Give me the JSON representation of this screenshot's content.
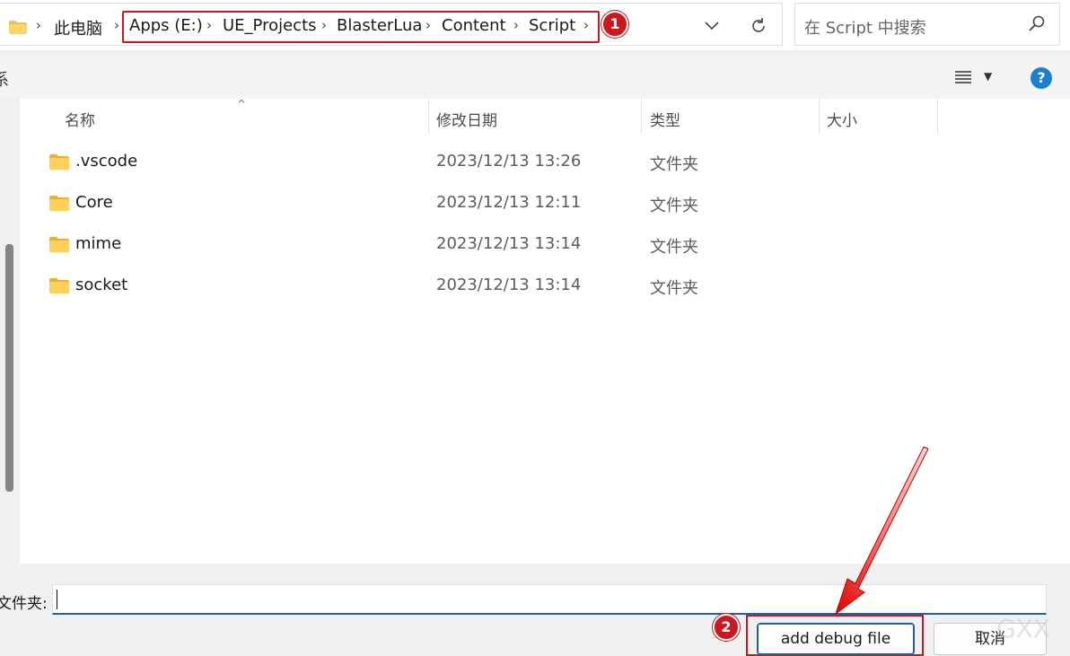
{
  "address_bar": {
    "root": "此电脑",
    "crumbs": [
      "Apps (E:)",
      "UE_Projects",
      "BlasterLua",
      "Content",
      "Script"
    ],
    "refresh_icon": "refresh-icon",
    "dropdown_icon": "chevron-down-icon"
  },
  "search": {
    "placeholder": "在 Script 中搜索",
    "icon": "search-icon"
  },
  "toolbar": {
    "left_text": "系",
    "view_icon": "list-view-icon",
    "help_label": "?"
  },
  "columns": {
    "name": "名称",
    "date": "修改日期",
    "type": "类型",
    "size": "大小"
  },
  "files": [
    {
      "name": ".vscode",
      "date": "2023/12/13 13:26",
      "type": "文件夹"
    },
    {
      "name": "Core",
      "date": "2023/12/13 12:11",
      "type": "文件夹"
    },
    {
      "name": "mime",
      "date": "2023/12/13 13:14",
      "type": "文件夹"
    },
    {
      "name": "socket",
      "date": "2023/12/13 13:14",
      "type": "文件夹"
    }
  ],
  "bottom": {
    "folder_label": "文件夹:",
    "folder_value": "",
    "primary_button": "add debug file",
    "cancel_button": "取消",
    "watermark": "GXX"
  },
  "annotations": {
    "badge1": "1",
    "badge2": "2"
  },
  "colors": {
    "highlight_red": "#d0161c",
    "accent_blue": "#1a5fb4",
    "help_blue": "#1a7fd4"
  }
}
